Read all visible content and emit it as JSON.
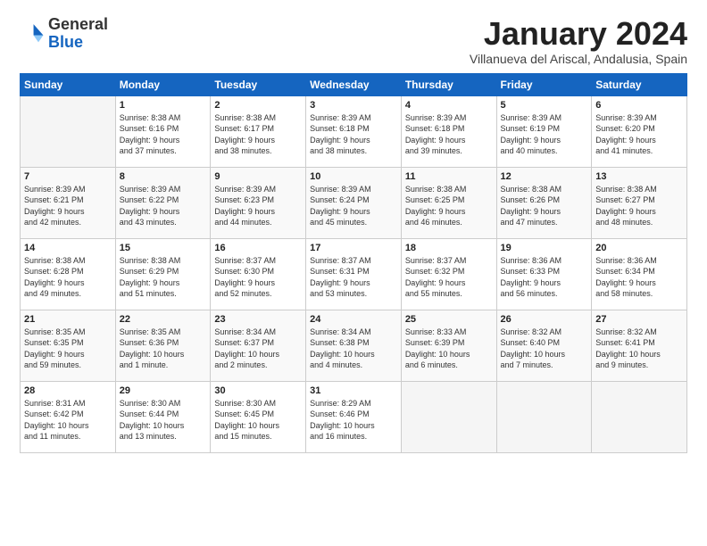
{
  "logo": {
    "general": "General",
    "blue": "Blue"
  },
  "header": {
    "month": "January 2024",
    "location": "Villanueva del Ariscal, Andalusia, Spain"
  },
  "days_of_week": [
    "Sunday",
    "Monday",
    "Tuesday",
    "Wednesday",
    "Thursday",
    "Friday",
    "Saturday"
  ],
  "weeks": [
    [
      {
        "day": "",
        "info": ""
      },
      {
        "day": "1",
        "info": "Sunrise: 8:38 AM\nSunset: 6:16 PM\nDaylight: 9 hours\nand 37 minutes."
      },
      {
        "day": "2",
        "info": "Sunrise: 8:38 AM\nSunset: 6:17 PM\nDaylight: 9 hours\nand 38 minutes."
      },
      {
        "day": "3",
        "info": "Sunrise: 8:39 AM\nSunset: 6:18 PM\nDaylight: 9 hours\nand 38 minutes."
      },
      {
        "day": "4",
        "info": "Sunrise: 8:39 AM\nSunset: 6:18 PM\nDaylight: 9 hours\nand 39 minutes."
      },
      {
        "day": "5",
        "info": "Sunrise: 8:39 AM\nSunset: 6:19 PM\nDaylight: 9 hours\nand 40 minutes."
      },
      {
        "day": "6",
        "info": "Sunrise: 8:39 AM\nSunset: 6:20 PM\nDaylight: 9 hours\nand 41 minutes."
      }
    ],
    [
      {
        "day": "7",
        "info": "Sunrise: 8:39 AM\nSunset: 6:21 PM\nDaylight: 9 hours\nand 42 minutes."
      },
      {
        "day": "8",
        "info": "Sunrise: 8:39 AM\nSunset: 6:22 PM\nDaylight: 9 hours\nand 43 minutes."
      },
      {
        "day": "9",
        "info": "Sunrise: 8:39 AM\nSunset: 6:23 PM\nDaylight: 9 hours\nand 44 minutes."
      },
      {
        "day": "10",
        "info": "Sunrise: 8:39 AM\nSunset: 6:24 PM\nDaylight: 9 hours\nand 45 minutes."
      },
      {
        "day": "11",
        "info": "Sunrise: 8:38 AM\nSunset: 6:25 PM\nDaylight: 9 hours\nand 46 minutes."
      },
      {
        "day": "12",
        "info": "Sunrise: 8:38 AM\nSunset: 6:26 PM\nDaylight: 9 hours\nand 47 minutes."
      },
      {
        "day": "13",
        "info": "Sunrise: 8:38 AM\nSunset: 6:27 PM\nDaylight: 9 hours\nand 48 minutes."
      }
    ],
    [
      {
        "day": "14",
        "info": "Sunrise: 8:38 AM\nSunset: 6:28 PM\nDaylight: 9 hours\nand 49 minutes."
      },
      {
        "day": "15",
        "info": "Sunrise: 8:38 AM\nSunset: 6:29 PM\nDaylight: 9 hours\nand 51 minutes."
      },
      {
        "day": "16",
        "info": "Sunrise: 8:37 AM\nSunset: 6:30 PM\nDaylight: 9 hours\nand 52 minutes."
      },
      {
        "day": "17",
        "info": "Sunrise: 8:37 AM\nSunset: 6:31 PM\nDaylight: 9 hours\nand 53 minutes."
      },
      {
        "day": "18",
        "info": "Sunrise: 8:37 AM\nSunset: 6:32 PM\nDaylight: 9 hours\nand 55 minutes."
      },
      {
        "day": "19",
        "info": "Sunrise: 8:36 AM\nSunset: 6:33 PM\nDaylight: 9 hours\nand 56 minutes."
      },
      {
        "day": "20",
        "info": "Sunrise: 8:36 AM\nSunset: 6:34 PM\nDaylight: 9 hours\nand 58 minutes."
      }
    ],
    [
      {
        "day": "21",
        "info": "Sunrise: 8:35 AM\nSunset: 6:35 PM\nDaylight: 9 hours\nand 59 minutes."
      },
      {
        "day": "22",
        "info": "Sunrise: 8:35 AM\nSunset: 6:36 PM\nDaylight: 10 hours\nand 1 minute."
      },
      {
        "day": "23",
        "info": "Sunrise: 8:34 AM\nSunset: 6:37 PM\nDaylight: 10 hours\nand 2 minutes."
      },
      {
        "day": "24",
        "info": "Sunrise: 8:34 AM\nSunset: 6:38 PM\nDaylight: 10 hours\nand 4 minutes."
      },
      {
        "day": "25",
        "info": "Sunrise: 8:33 AM\nSunset: 6:39 PM\nDaylight: 10 hours\nand 6 minutes."
      },
      {
        "day": "26",
        "info": "Sunrise: 8:32 AM\nSunset: 6:40 PM\nDaylight: 10 hours\nand 7 minutes."
      },
      {
        "day": "27",
        "info": "Sunrise: 8:32 AM\nSunset: 6:41 PM\nDaylight: 10 hours\nand 9 minutes."
      }
    ],
    [
      {
        "day": "28",
        "info": "Sunrise: 8:31 AM\nSunset: 6:42 PM\nDaylight: 10 hours\nand 11 minutes."
      },
      {
        "day": "29",
        "info": "Sunrise: 8:30 AM\nSunset: 6:44 PM\nDaylight: 10 hours\nand 13 minutes."
      },
      {
        "day": "30",
        "info": "Sunrise: 8:30 AM\nSunset: 6:45 PM\nDaylight: 10 hours\nand 15 minutes."
      },
      {
        "day": "31",
        "info": "Sunrise: 8:29 AM\nSunset: 6:46 PM\nDaylight: 10 hours\nand 16 minutes."
      },
      {
        "day": "",
        "info": ""
      },
      {
        "day": "",
        "info": ""
      },
      {
        "day": "",
        "info": ""
      }
    ]
  ]
}
